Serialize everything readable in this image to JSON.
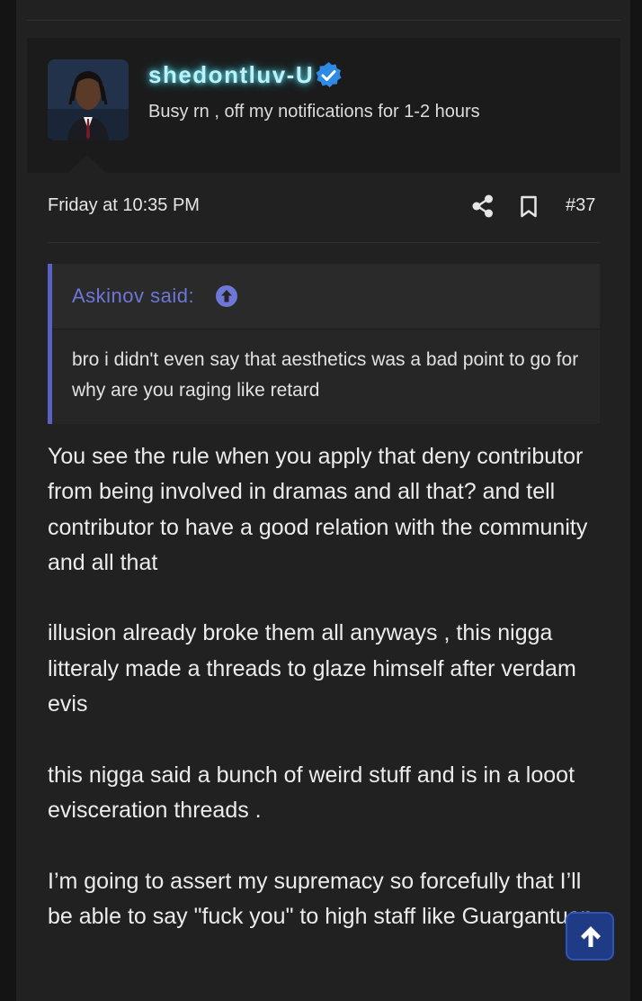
{
  "post": {
    "author": {
      "username": "shedontluv-U",
      "verified": true,
      "title": "Busy rn , off my notifications for 1-2 hours"
    },
    "meta": {
      "date": "Friday at 10:35 PM",
      "number": "#37"
    },
    "quote": {
      "author": "Askinov said:",
      "text": "bro i didn't even say that aesthetics was a bad point to go for why are you raging like retard"
    },
    "paragraphs": [
      "You see the rule when you apply that deny contributor from being involved in dramas and all that? and tell contributor to have a good relation with the community and all that",
      "illusion already broke them all anyways , this nigga litteraly made a threads to glaze himself after verdam evis",
      "this nigga said a bunch of weird stuff and is in a looot evisceration threads .",
      "I’m going to assert my supremacy so forcefully that I’ll be able to say \"fuck you\" to high staff like Guargantuan"
    ]
  },
  "icons": {
    "verified": "verified-check-icon",
    "share": "share-icon",
    "bookmark": "bookmark-icon",
    "quote_jump": "arrow-up-circle-icon",
    "scroll_top": "arrow-up-icon"
  },
  "colors": {
    "background": "#212121",
    "username_glow": "#5fd6e6",
    "verified": "#2f8ae6",
    "quote_accent": "#5a61c4",
    "scroll_button": "#1f3b86"
  }
}
